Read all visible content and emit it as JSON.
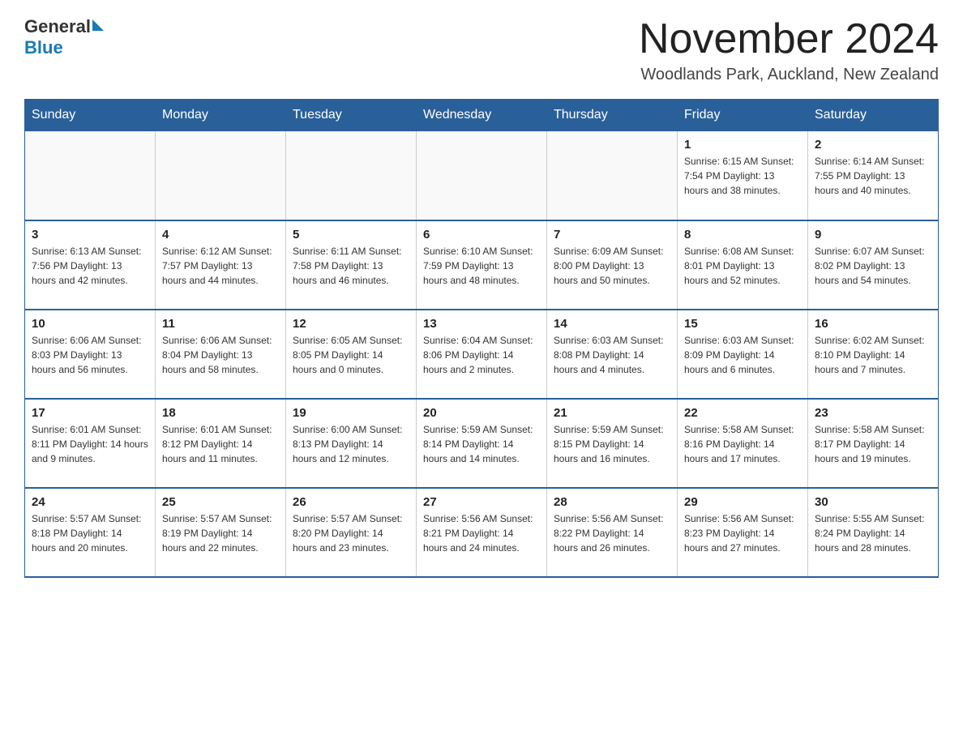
{
  "header": {
    "logo": {
      "general": "General",
      "blue": "Blue"
    },
    "title": "November 2024",
    "location": "Woodlands Park, Auckland, New Zealand"
  },
  "calendar": {
    "days_of_week": [
      "Sunday",
      "Monday",
      "Tuesday",
      "Wednesday",
      "Thursday",
      "Friday",
      "Saturday"
    ],
    "weeks": [
      [
        {
          "day": "",
          "info": ""
        },
        {
          "day": "",
          "info": ""
        },
        {
          "day": "",
          "info": ""
        },
        {
          "day": "",
          "info": ""
        },
        {
          "day": "",
          "info": ""
        },
        {
          "day": "1",
          "info": "Sunrise: 6:15 AM\nSunset: 7:54 PM\nDaylight: 13 hours and 38 minutes."
        },
        {
          "day": "2",
          "info": "Sunrise: 6:14 AM\nSunset: 7:55 PM\nDaylight: 13 hours and 40 minutes."
        }
      ],
      [
        {
          "day": "3",
          "info": "Sunrise: 6:13 AM\nSunset: 7:56 PM\nDaylight: 13 hours and 42 minutes."
        },
        {
          "day": "4",
          "info": "Sunrise: 6:12 AM\nSunset: 7:57 PM\nDaylight: 13 hours and 44 minutes."
        },
        {
          "day": "5",
          "info": "Sunrise: 6:11 AM\nSunset: 7:58 PM\nDaylight: 13 hours and 46 minutes."
        },
        {
          "day": "6",
          "info": "Sunrise: 6:10 AM\nSunset: 7:59 PM\nDaylight: 13 hours and 48 minutes."
        },
        {
          "day": "7",
          "info": "Sunrise: 6:09 AM\nSunset: 8:00 PM\nDaylight: 13 hours and 50 minutes."
        },
        {
          "day": "8",
          "info": "Sunrise: 6:08 AM\nSunset: 8:01 PM\nDaylight: 13 hours and 52 minutes."
        },
        {
          "day": "9",
          "info": "Sunrise: 6:07 AM\nSunset: 8:02 PM\nDaylight: 13 hours and 54 minutes."
        }
      ],
      [
        {
          "day": "10",
          "info": "Sunrise: 6:06 AM\nSunset: 8:03 PM\nDaylight: 13 hours and 56 minutes."
        },
        {
          "day": "11",
          "info": "Sunrise: 6:06 AM\nSunset: 8:04 PM\nDaylight: 13 hours and 58 minutes."
        },
        {
          "day": "12",
          "info": "Sunrise: 6:05 AM\nSunset: 8:05 PM\nDaylight: 14 hours and 0 minutes."
        },
        {
          "day": "13",
          "info": "Sunrise: 6:04 AM\nSunset: 8:06 PM\nDaylight: 14 hours and 2 minutes."
        },
        {
          "day": "14",
          "info": "Sunrise: 6:03 AM\nSunset: 8:08 PM\nDaylight: 14 hours and 4 minutes."
        },
        {
          "day": "15",
          "info": "Sunrise: 6:03 AM\nSunset: 8:09 PM\nDaylight: 14 hours and 6 minutes."
        },
        {
          "day": "16",
          "info": "Sunrise: 6:02 AM\nSunset: 8:10 PM\nDaylight: 14 hours and 7 minutes."
        }
      ],
      [
        {
          "day": "17",
          "info": "Sunrise: 6:01 AM\nSunset: 8:11 PM\nDaylight: 14 hours and 9 minutes."
        },
        {
          "day": "18",
          "info": "Sunrise: 6:01 AM\nSunset: 8:12 PM\nDaylight: 14 hours and 11 minutes."
        },
        {
          "day": "19",
          "info": "Sunrise: 6:00 AM\nSunset: 8:13 PM\nDaylight: 14 hours and 12 minutes."
        },
        {
          "day": "20",
          "info": "Sunrise: 5:59 AM\nSunset: 8:14 PM\nDaylight: 14 hours and 14 minutes."
        },
        {
          "day": "21",
          "info": "Sunrise: 5:59 AM\nSunset: 8:15 PM\nDaylight: 14 hours and 16 minutes."
        },
        {
          "day": "22",
          "info": "Sunrise: 5:58 AM\nSunset: 8:16 PM\nDaylight: 14 hours and 17 minutes."
        },
        {
          "day": "23",
          "info": "Sunrise: 5:58 AM\nSunset: 8:17 PM\nDaylight: 14 hours and 19 minutes."
        }
      ],
      [
        {
          "day": "24",
          "info": "Sunrise: 5:57 AM\nSunset: 8:18 PM\nDaylight: 14 hours and 20 minutes."
        },
        {
          "day": "25",
          "info": "Sunrise: 5:57 AM\nSunset: 8:19 PM\nDaylight: 14 hours and 22 minutes."
        },
        {
          "day": "26",
          "info": "Sunrise: 5:57 AM\nSunset: 8:20 PM\nDaylight: 14 hours and 23 minutes."
        },
        {
          "day": "27",
          "info": "Sunrise: 5:56 AM\nSunset: 8:21 PM\nDaylight: 14 hours and 24 minutes."
        },
        {
          "day": "28",
          "info": "Sunrise: 5:56 AM\nSunset: 8:22 PM\nDaylight: 14 hours and 26 minutes."
        },
        {
          "day": "29",
          "info": "Sunrise: 5:56 AM\nSunset: 8:23 PM\nDaylight: 14 hours and 27 minutes."
        },
        {
          "day": "30",
          "info": "Sunrise: 5:55 AM\nSunset: 8:24 PM\nDaylight: 14 hours and 28 minutes."
        }
      ]
    ]
  }
}
